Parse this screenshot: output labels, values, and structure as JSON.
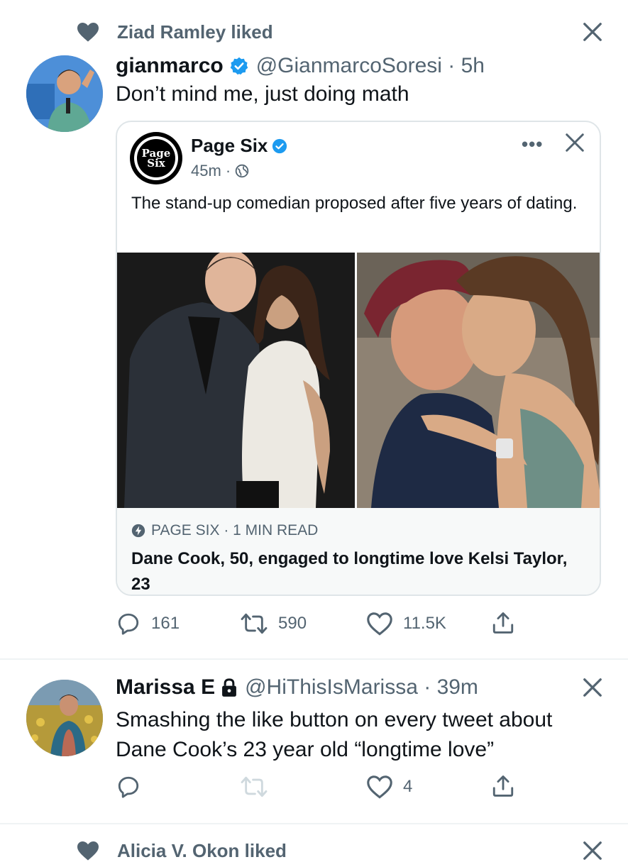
{
  "tweet1": {
    "social_context": "Ziad Ramley liked",
    "author_name": "gianmarco",
    "handle_time": "@GianmarcoSoresi · 5h",
    "text": "Don’t mind me, just doing math",
    "quoted": {
      "account_name": "Page Six",
      "logo_text_1": "Page",
      "logo_text_2": "Six",
      "time": "45m ·",
      "more_label": "•••",
      "text": "The stand-up comedian proposed after five years of dating.",
      "info_label": "i",
      "link_source": "PAGE SIX · 1 MIN READ",
      "link_title": "Dane Cook, 50, engaged to longtime love Kelsi Taylor, 23"
    },
    "actions": {
      "replies": "161",
      "retweets": "590",
      "likes": "11.5K"
    }
  },
  "tweet2": {
    "author_name": "Marissa E",
    "handle_time": "@HiThisIsMarissa · 39m",
    "text": "Smashing the like button on every tweet about Dane Cook’s 23 year old “longtime love”",
    "actions": {
      "replies": "",
      "retweets": "",
      "likes": "4"
    }
  },
  "tweet3": {
    "social_context": "Alicia V. Okon liked"
  },
  "colors": {
    "text": "#0f1419",
    "muted": "#536471",
    "verified_blue": "#1d9bf0",
    "divider": "#eff3f4"
  }
}
